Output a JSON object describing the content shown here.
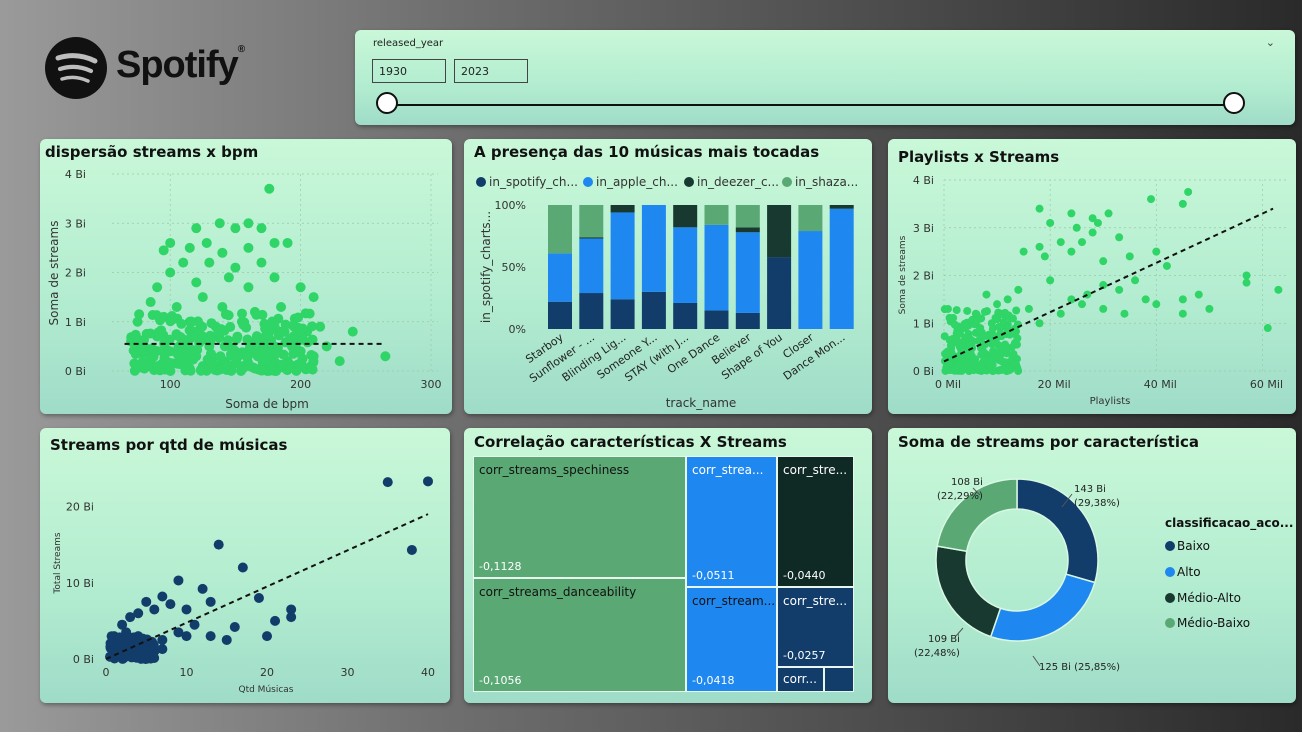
{
  "brand": {
    "name": "Spotify",
    "reg": "®"
  },
  "slicer": {
    "field": "released_year",
    "from": "1930",
    "to": "2023",
    "range": [
      1930,
      2023
    ],
    "selected": [
      1930,
      2023
    ]
  },
  "scatter_bpm": {
    "title": "dispersão streams x bpm",
    "ylabel": "Soma de streams",
    "xlabel": "Soma de bpm",
    "yticks": [
      "0 Bi",
      "1 Bi",
      "2 Bi",
      "3 Bi",
      "4 Bi"
    ],
    "xticks": [
      "100",
      "200",
      "300"
    ],
    "color": "#2fd566"
  },
  "top10": {
    "title": "A presença das 10 músicas mais tocadas",
    "legend": [
      "in_spotify_ch...",
      "in_apple_ch...",
      "in_deezer_c...",
      "in_shaza..."
    ],
    "ylabel": "in_spotify_charts...",
    "xlabel": "track_name",
    "yticks": [
      "0%",
      "50%",
      "100%"
    ],
    "tracks": [
      "Starboy",
      "Sunflower - ...",
      "Blinding Lig...",
      "Someone Y...",
      "STAY (with J...",
      "One Dance",
      "Believer",
      "Shape of You",
      "Closer",
      "Dance Mon..."
    ],
    "colors": [
      "#123d6b",
      "#1e88f0",
      "#17392f",
      "#5aa874"
    ]
  },
  "playlists": {
    "title": "Playlists x Streams",
    "ylabel": "Soma de streams",
    "xlabel": "Playlists",
    "yticks": [
      "0 Bi",
      "1 Bi",
      "2 Bi",
      "3 Bi",
      "4 Bi"
    ],
    "xticks": [
      "0 Mil",
      "20 Mil",
      "40 Mil",
      "60 Mil"
    ]
  },
  "qtd": {
    "title": "Streams por qtd de músicas",
    "ylabel": "Total Streams",
    "xlabel": "Qtd Músicas",
    "yticks": [
      "0 Bi",
      "10 Bi",
      "20 Bi"
    ],
    "xticks": [
      "0",
      "10",
      "20",
      "30",
      "40"
    ]
  },
  "treemap": {
    "title": "Correlação características X Streams",
    "cells": [
      {
        "label": "corr_streams_spechiness",
        "value": "-0,1128"
      },
      {
        "label": "corr_streams_danceability",
        "value": "-0,1056"
      },
      {
        "label": "corr_strea...",
        "value": "-0,0511"
      },
      {
        "label": "corr_stream...",
        "value": "-0,0418"
      },
      {
        "label": "corr_stre...",
        "value": "-0,0440"
      },
      {
        "label": "corr_stre...",
        "value": "-0,0257"
      },
      {
        "label": "corr...",
        "value": ""
      }
    ]
  },
  "donut": {
    "title": "Soma de streams por característica",
    "legend_title": "classificacao_aco...",
    "items": [
      {
        "name": "Baixo",
        "color": "#123d6b",
        "label1": "143 Bi",
        "label2": "(29,38%)"
      },
      {
        "name": "Alto",
        "color": "#1e88f0",
        "label1": "125 Bi (25,85%)",
        "label2": ""
      },
      {
        "name": "Médio-Alto",
        "color": "#17392f",
        "label1": "109 Bi",
        "label2": "(22,48%)"
      },
      {
        "name": "Médio-Baixo",
        "color": "#5aa874",
        "label1": "108 Bi",
        "label2": "(22,29%)"
      }
    ]
  },
  "chart_data": [
    {
      "type": "scatter",
      "title": "dispersão streams x bpm",
      "xlabel": "Soma de bpm",
      "ylabel": "Soma de streams",
      "xlim": [
        50,
        300
      ],
      "ylim": [
        0,
        4
      ],
      "points": [
        [
          176,
          3.7
        ],
        [
          120,
          2.9
        ],
        [
          138,
          3.0
        ],
        [
          150,
          2.9
        ],
        [
          160,
          3.0
        ],
        [
          170,
          2.9
        ],
        [
          128,
          2.6
        ],
        [
          100,
          2.6
        ],
        [
          95,
          2.45
        ],
        [
          180,
          2.6
        ],
        [
          190,
          2.6
        ],
        [
          160,
          2.5
        ],
        [
          140,
          2.4
        ],
        [
          115,
          2.5
        ],
        [
          110,
          2.2
        ],
        [
          130,
          2.2
        ],
        [
          150,
          2.1
        ],
        [
          170,
          2.2
        ],
        [
          100,
          2.0
        ],
        [
          120,
          1.8
        ],
        [
          145,
          1.9
        ],
        [
          160,
          1.7
        ],
        [
          180,
          1.9
        ],
        [
          90,
          1.7
        ],
        [
          200,
          1.7
        ],
        [
          210,
          1.5
        ],
        [
          85,
          1.4
        ],
        [
          105,
          1.3
        ],
        [
          125,
          1.5
        ],
        [
          140,
          1.3
        ],
        [
          165,
          1.2
        ],
        [
          185,
          1.3
        ],
        [
          75,
          1.0
        ],
        [
          95,
          1.1
        ],
        [
          115,
          1.0
        ],
        [
          135,
          0.9
        ],
        [
          155,
          1.0
        ],
        [
          175,
          0.8
        ],
        [
          195,
          0.9
        ],
        [
          205,
          0.8
        ],
        [
          215,
          0.9
        ],
        [
          240,
          0.8
        ],
        [
          70,
          0.6
        ],
        [
          80,
          0.5
        ],
        [
          90,
          0.7
        ],
        [
          100,
          0.4
        ],
        [
          110,
          0.6
        ],
        [
          120,
          0.3
        ],
        [
          130,
          0.5
        ],
        [
          140,
          0.2
        ],
        [
          150,
          0.4
        ],
        [
          160,
          0.6
        ],
        [
          170,
          0.3
        ],
        [
          180,
          0.5
        ],
        [
          190,
          0.2
        ],
        [
          200,
          0.4
        ],
        [
          210,
          0.3
        ],
        [
          220,
          0.5
        ],
        [
          230,
          0.2
        ],
        [
          265,
          0.3
        ],
        [
          85,
          0.2
        ],
        [
          95,
          0.1
        ],
        [
          105,
          0.15
        ],
        [
          115,
          0.05
        ],
        [
          125,
          0.1
        ],
        [
          135,
          0.12
        ],
        [
          145,
          0.08
        ],
        [
          155,
          0.1
        ],
        [
          165,
          0.05
        ],
        [
          175,
          0.1
        ],
        [
          185,
          0.08
        ],
        [
          195,
          0.1
        ]
      ],
      "trend": [
        [
          65,
          0.55
        ],
        [
          265,
          0.55
        ]
      ]
    },
    {
      "type": "bar",
      "title": "A presença das 10 músicas mais tocadas",
      "stacked_percent": true,
      "categories": [
        "Starboy",
        "Sunflower - ...",
        "Blinding Lig...",
        "Someone Y...",
        "STAY (with J...",
        "One Dance",
        "Believer",
        "Shape of You",
        "Closer",
        "Dance Mon..."
      ],
      "series": [
        {
          "name": "in_spotify_ch...",
          "values": [
            22,
            29,
            24,
            30,
            21,
            15,
            13,
            58,
            0,
            0
          ]
        },
        {
          "name": "in_apple_ch...",
          "values": [
            39,
            44,
            70,
            70,
            61,
            69,
            65,
            0,
            79,
            97
          ]
        },
        {
          "name": "in_deezer_c...",
          "values": [
            0,
            1,
            6,
            0,
            18,
            0,
            4,
            42,
            0,
            3
          ]
        },
        {
          "name": "in_shaza...",
          "values": [
            39,
            26,
            0,
            0,
            0,
            16,
            18,
            0,
            21,
            0
          ]
        }
      ]
    },
    {
      "type": "scatter",
      "title": "Playlists x Streams",
      "xlabel": "Playlists",
      "ylabel": "Soma de streams",
      "xlim": [
        0,
        65
      ],
      "ylim": [
        0,
        4
      ],
      "points": [
        [
          46,
          3.75
        ],
        [
          39,
          3.6
        ],
        [
          45,
          3.5
        ],
        [
          18,
          3.4
        ],
        [
          24,
          3.3
        ],
        [
          20,
          3.1
        ],
        [
          28,
          3.2
        ],
        [
          31,
          3.3
        ],
        [
          25,
          3.0
        ],
        [
          29,
          3.1
        ],
        [
          26,
          2.7
        ],
        [
          33,
          2.8
        ],
        [
          28,
          2.9
        ],
        [
          22,
          2.7
        ],
        [
          18,
          2.6
        ],
        [
          15,
          2.5
        ],
        [
          19,
          2.4
        ],
        [
          24,
          2.5
        ],
        [
          30,
          2.3
        ],
        [
          35,
          2.4
        ],
        [
          40,
          2.5
        ],
        [
          42,
          2.2
        ],
        [
          57,
          2.0
        ],
        [
          57,
          1.85
        ],
        [
          63,
          1.7
        ],
        [
          48,
          1.6
        ],
        [
          45,
          1.5
        ],
        [
          38,
          1.5
        ],
        [
          36,
          1.9
        ],
        [
          33,
          1.7
        ],
        [
          30,
          1.8
        ],
        [
          27,
          1.6
        ],
        [
          20,
          1.9
        ],
        [
          14,
          1.7
        ],
        [
          12,
          1.5
        ],
        [
          10,
          1.4
        ],
        [
          8,
          1.6
        ],
        [
          6,
          1.2
        ],
        [
          5,
          1.0
        ],
        [
          4,
          0.9
        ],
        [
          3,
          0.8
        ],
        [
          2,
          0.6
        ],
        [
          1,
          0.4
        ],
        [
          2,
          0.3
        ],
        [
          3,
          0.5
        ],
        [
          4,
          0.7
        ],
        [
          6,
          0.8
        ],
        [
          7,
          1.1
        ],
        [
          9,
          1.0
        ],
        [
          11,
          1.2
        ],
        [
          13,
          1.1
        ],
        [
          16,
          1.3
        ],
        [
          18,
          1.0
        ],
        [
          22,
          1.2
        ],
        [
          24,
          1.5
        ],
        [
          26,
          1.4
        ],
        [
          30,
          1.3
        ],
        [
          34,
          1.2
        ],
        [
          40,
          1.4
        ],
        [
          45,
          1.2
        ],
        [
          50,
          1.3
        ],
        [
          61,
          0.9
        ],
        [
          1,
          0.1
        ],
        [
          2,
          0.15
        ],
        [
          0.5,
          0.05
        ],
        [
          3,
          0.2
        ]
      ],
      "trend": [
        [
          0,
          0.2
        ],
        [
          62,
          3.4
        ]
      ]
    },
    {
      "type": "scatter",
      "title": "Streams por qtd de músicas",
      "xlabel": "Qtd Músicas",
      "ylabel": "Total Streams",
      "xlim": [
        0,
        40
      ],
      "ylim": [
        0,
        24
      ],
      "points": [
        [
          35,
          23.2
        ],
        [
          40,
          23.3
        ],
        [
          38,
          14.3
        ],
        [
          14,
          15
        ],
        [
          17,
          12
        ],
        [
          9,
          10.3
        ],
        [
          12,
          9.2
        ],
        [
          7,
          8.2
        ],
        [
          8,
          7.2
        ],
        [
          13,
          7.5
        ],
        [
          19,
          8
        ],
        [
          10,
          6.5
        ],
        [
          5,
          7.5
        ],
        [
          6,
          6.5
        ],
        [
          4,
          6
        ],
        [
          3,
          5.5
        ],
        [
          2,
          4.5
        ],
        [
          23,
          5.5
        ],
        [
          21,
          5
        ],
        [
          23,
          6.5
        ],
        [
          11,
          4.5
        ],
        [
          16,
          4.2
        ],
        [
          13,
          3
        ],
        [
          10,
          3
        ],
        [
          7,
          2.5
        ],
        [
          5,
          2
        ],
        [
          4,
          3
        ],
        [
          3,
          2.5
        ],
        [
          2,
          1.8
        ],
        [
          1,
          1
        ],
        [
          2,
          0.5
        ],
        [
          3,
          1.2
        ],
        [
          4,
          0.8
        ],
        [
          5,
          1.5
        ],
        [
          6,
          1
        ],
        [
          7,
          1.3
        ],
        [
          9,
          3.5
        ],
        [
          15,
          2.5
        ],
        [
          20,
          3
        ],
        [
          1,
          3
        ],
        [
          1.5,
          2
        ],
        [
          2.5,
          3.5
        ],
        [
          0.5,
          0.3
        ]
      ],
      "trend": [
        [
          0,
          0
        ],
        [
          40,
          19
        ]
      ]
    },
    {
      "type": "treemap",
      "title": "Correlação características X Streams",
      "values": [
        -0.1128,
        -0.1056,
        -0.0511,
        -0.0418,
        -0.044,
        -0.0257
      ]
    },
    {
      "type": "pie",
      "title": "Soma de streams por característica",
      "donut": true,
      "categories": [
        "Baixo",
        "Alto",
        "Médio-Alto",
        "Médio-Baixo"
      ],
      "values": [
        143,
        125,
        109,
        108
      ],
      "percent": [
        29.38,
        25.85,
        22.48,
        22.29
      ]
    }
  ]
}
